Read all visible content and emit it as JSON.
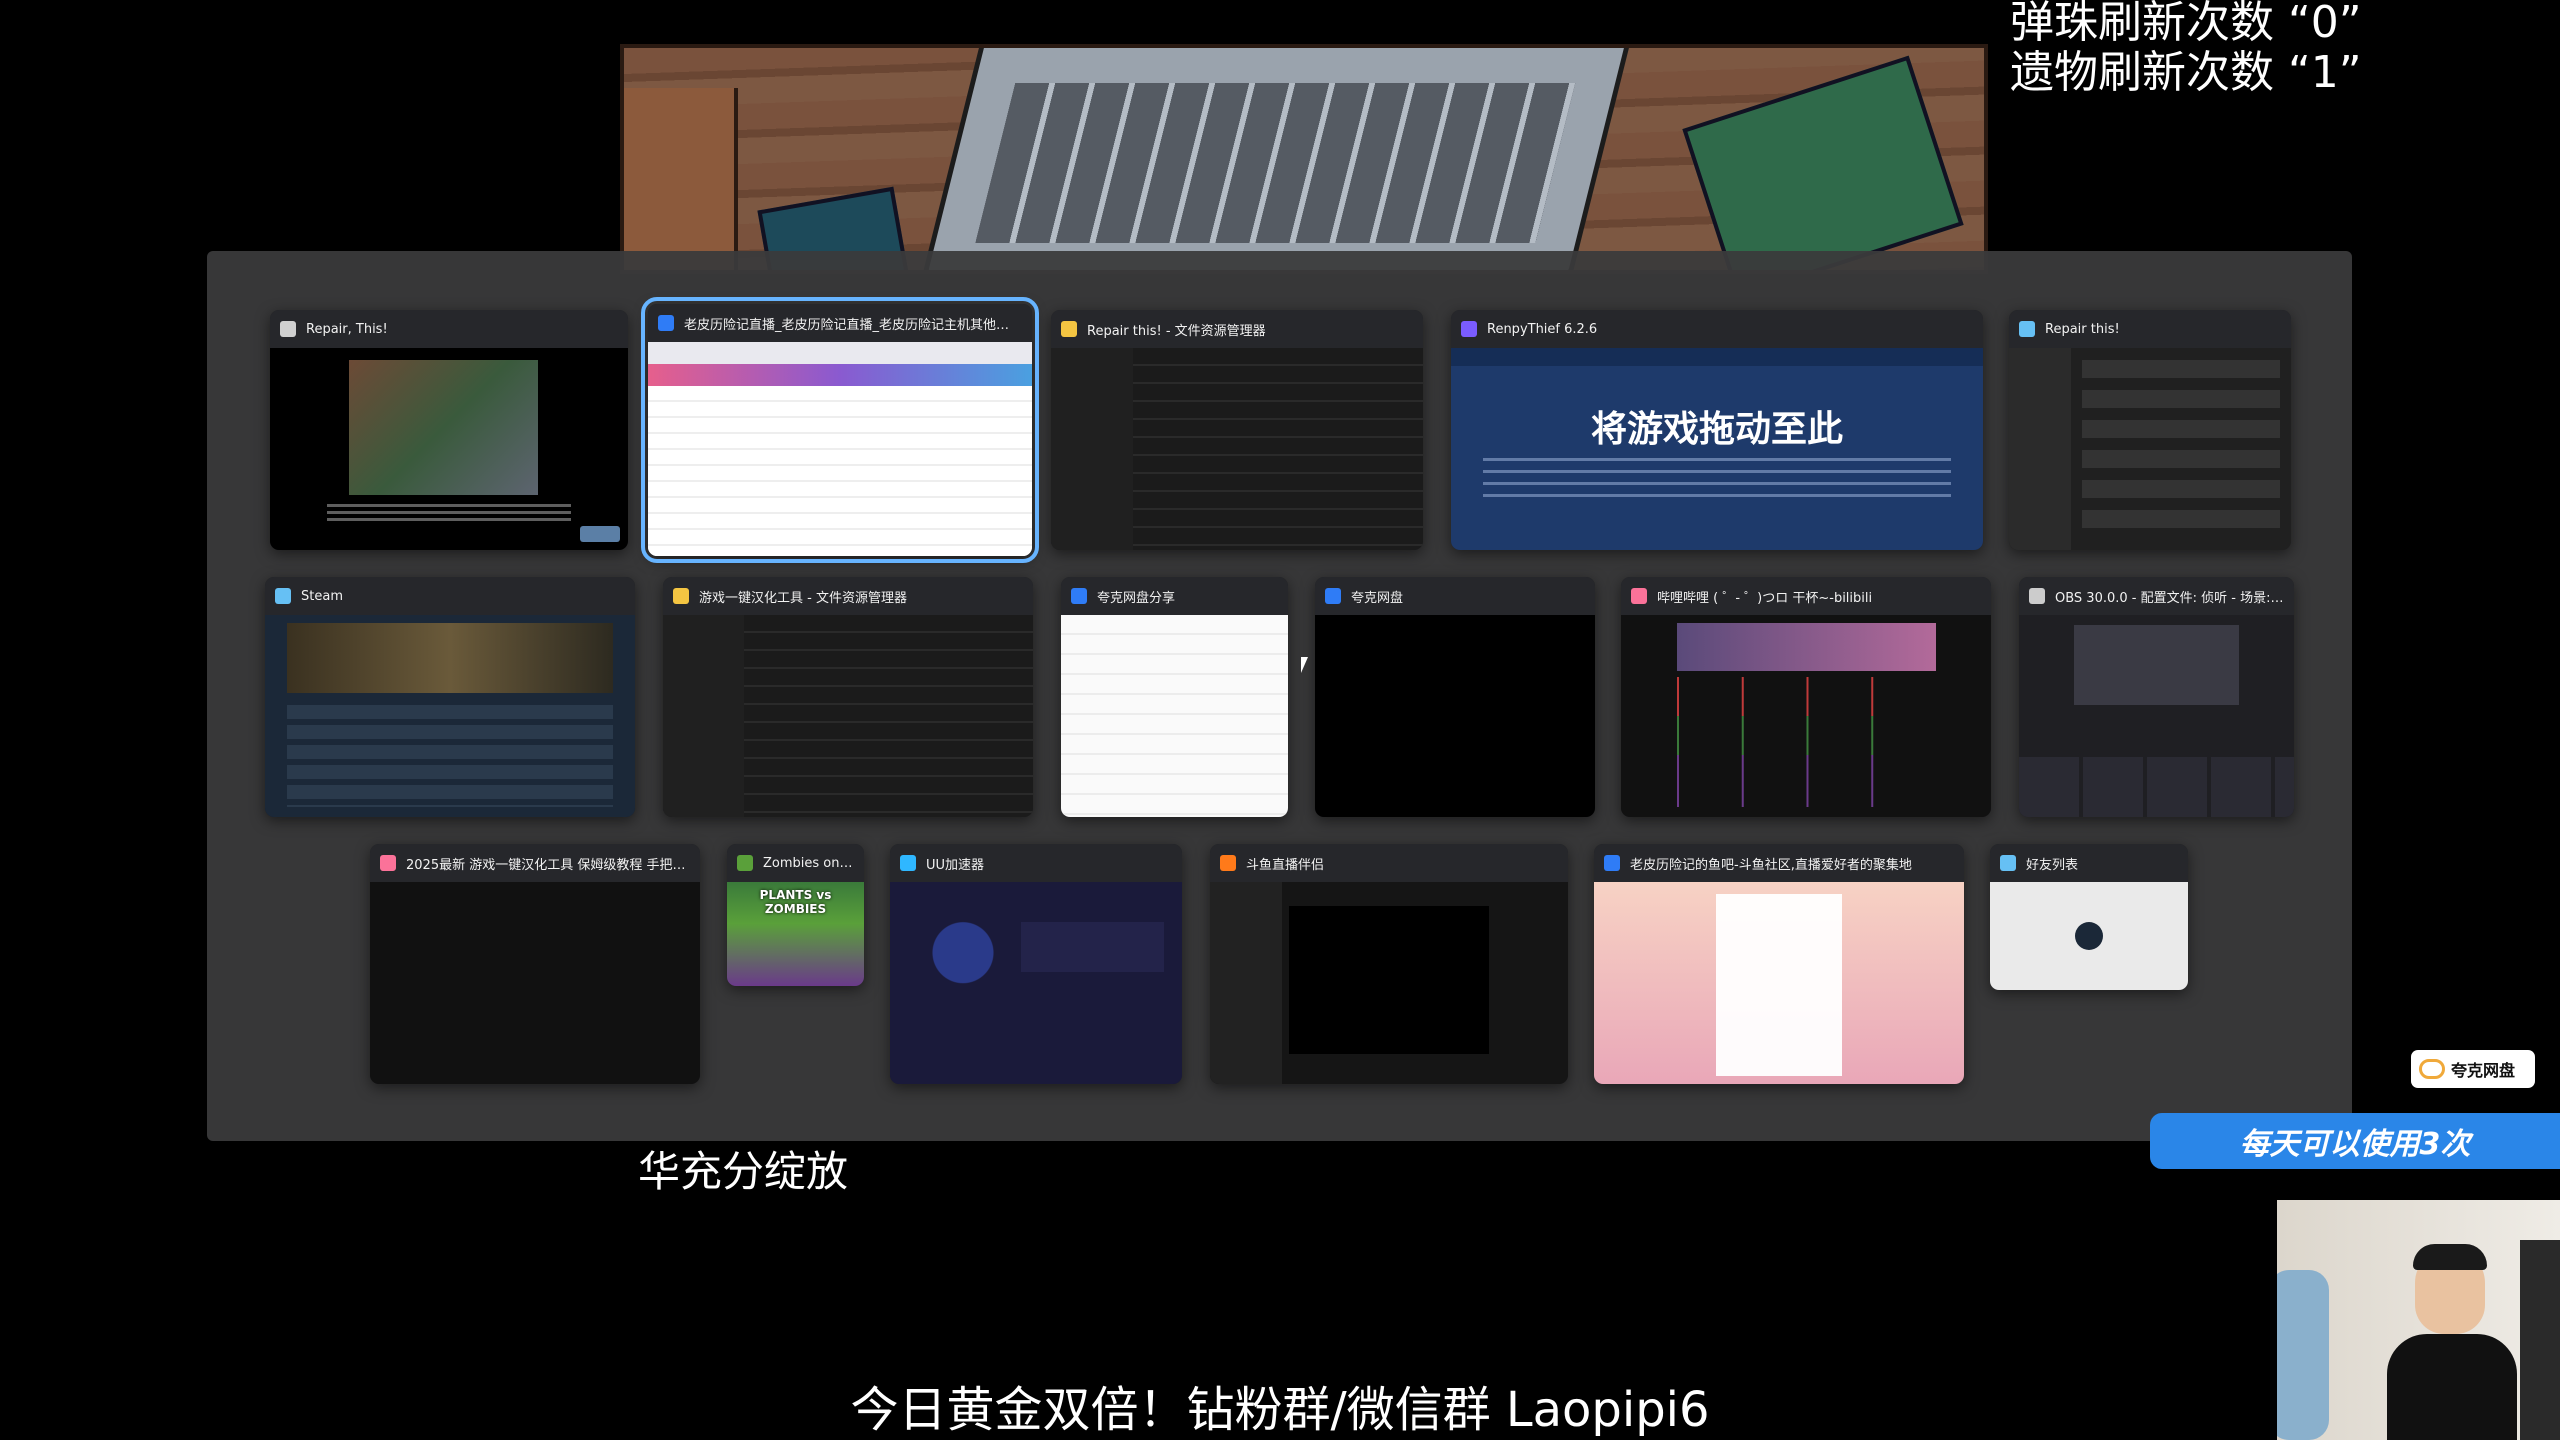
{
  "overlay": {
    "counts_line1": "弹珠刷新次数 “0”",
    "counts_line2": "遗物刷新次数 “1”",
    "subtitle_mid": "华充分绽放",
    "subtitle_bottom": "今日黄金双倍！钻粉群/微信群 Laopipi6",
    "promo_banner": "每天可以使用3次",
    "quark_badge": "夸克网盘"
  },
  "task_view": {
    "windows": [
      {
        "title": "Repair, This!",
        "icon": "repair-game-icon",
        "icon_color": "#d0d0d0",
        "content": "game-scene",
        "selected": false
      },
      {
        "title": "老皮历险记直播_老皮历险记直播_老皮历险记主机其他游戏...",
        "icon": "quark-browser-icon",
        "icon_color": "#2f7cf6",
        "content": "browser",
        "selected": true
      },
      {
        "title": "Repair this! - 文件资源管理器",
        "icon": "folder-icon",
        "icon_color": "#f4c542",
        "content": "explorer",
        "selected": false
      },
      {
        "title": "RenpyThief 6.2.6",
        "icon": "renpythief-icon",
        "icon_color": "#7a5cff",
        "content": "renpy",
        "selected": false,
        "content_text": "将游戏拖动至此"
      },
      {
        "title": "Repair this!",
        "icon": "steam-icon",
        "icon_color": "#66c0f4",
        "content": "settings",
        "selected": false
      },
      {
        "title": "Steam",
        "icon": "steam-icon",
        "icon_color": "#66c0f4",
        "content": "steam",
        "selected": false
      },
      {
        "title": "游戏一键汉化工具 - 文件资源管理器",
        "icon": "folder-icon",
        "icon_color": "#f4c542",
        "content": "explorer",
        "selected": false
      },
      {
        "title": "夸克网盘分享",
        "icon": "quark-browser-icon",
        "icon_color": "#2f7cf6",
        "content": "white",
        "selected": false
      },
      {
        "title": "夸克网盘",
        "icon": "quark-drive-icon",
        "icon_color": "#2f7cf6",
        "content": "black",
        "selected": false
      },
      {
        "title": "哔哩哔哩 ( ゜- ゜)つロ 干杯~-bilibili",
        "icon": "bilibili-icon",
        "icon_color": "#fb7299",
        "content": "bilibili",
        "selected": false
      },
      {
        "title": "OBS 30.0.0 - 配置文件: 侦听 - 场景: 未命名",
        "icon": "obs-icon",
        "icon_color": "#cccccc",
        "content": "obs",
        "selected": false
      },
      {
        "title": "2025最新 游戏一键汉化工具 保姆级教程 手把手教...",
        "icon": "bilibili-icon",
        "icon_color": "#fb7299",
        "content": "dark",
        "selected": false
      },
      {
        "title": "Zombies on Yo...",
        "icon": "pvz-icon",
        "icon_color": "#5aa03a",
        "content": "pvz",
        "selected": false,
        "content_text": "PLANTS vs ZOMBIES"
      },
      {
        "title": "UU加速器",
        "icon": "uu-icon",
        "icon_color": "#2fb7ff",
        "content": "uu",
        "selected": false
      },
      {
        "title": "斗鱼直播伴侣",
        "icon": "douyu-icon",
        "icon_color": "#ff7a1a",
        "content": "douyu",
        "selected": false
      },
      {
        "title": "老皮历险记的鱼吧-斗鱼社区,直播爱好者的聚集地",
        "icon": "quark-browser-icon",
        "icon_color": "#2f7cf6",
        "content": "forum",
        "selected": false
      },
      {
        "title": "好友列表",
        "icon": "steam-icon",
        "icon_color": "#66c0f4",
        "content": "friends",
        "selected": false
      }
    ]
  }
}
